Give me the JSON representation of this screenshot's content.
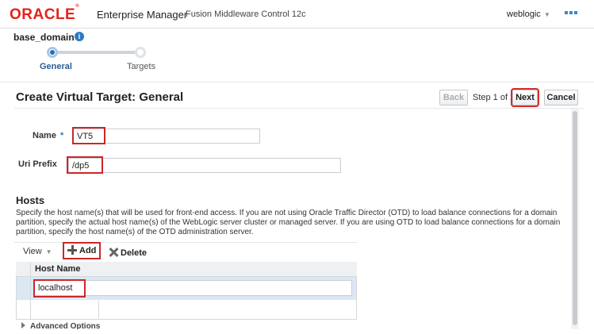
{
  "header": {
    "logo_text": "ORACLE",
    "app_title": "Enterprise Manager",
    "app_subtitle": "Fusion Middleware Control 12c",
    "user": "weblogic"
  },
  "domain": {
    "name": "base_domain",
    "info_glyph": "i"
  },
  "train": {
    "steps": [
      {
        "label": "General",
        "state": "current"
      },
      {
        "label": "Targets",
        "state": "pending"
      }
    ]
  },
  "page": {
    "title": "Create Virtual Target: General",
    "back_label": "Back",
    "step_text": "Step 1 of 2",
    "next_label": "Next",
    "cancel_label": "Cancel"
  },
  "form": {
    "name_label": "Name",
    "required_marker": "*",
    "name_value": "VT5",
    "uri_label": "Uri Prefix",
    "uri_value": "/dp5"
  },
  "hosts": {
    "heading": "Hosts",
    "description": "Specify the host name(s) that will be used for front-end access. If you are not using Oracle Traffic Director (OTD) to load balance connections for a domain partition, specify the actual host name(s) of the WebLogic server cluster or managed server. If you are using OTD to load balance connections for a domain partition, specify the host name(s) of the OTD administration server.",
    "view_label": "View",
    "add_label": "Add",
    "delete_label": "Delete",
    "column_header": "Host Name",
    "rows": [
      {
        "host_name": "localhost"
      }
    ]
  },
  "advanced": {
    "label": "Advanced Options"
  },
  "colors": {
    "oracle_red": "#e2231a",
    "highlight": "#cc2727",
    "accent_blue": "#2c7bc2"
  }
}
